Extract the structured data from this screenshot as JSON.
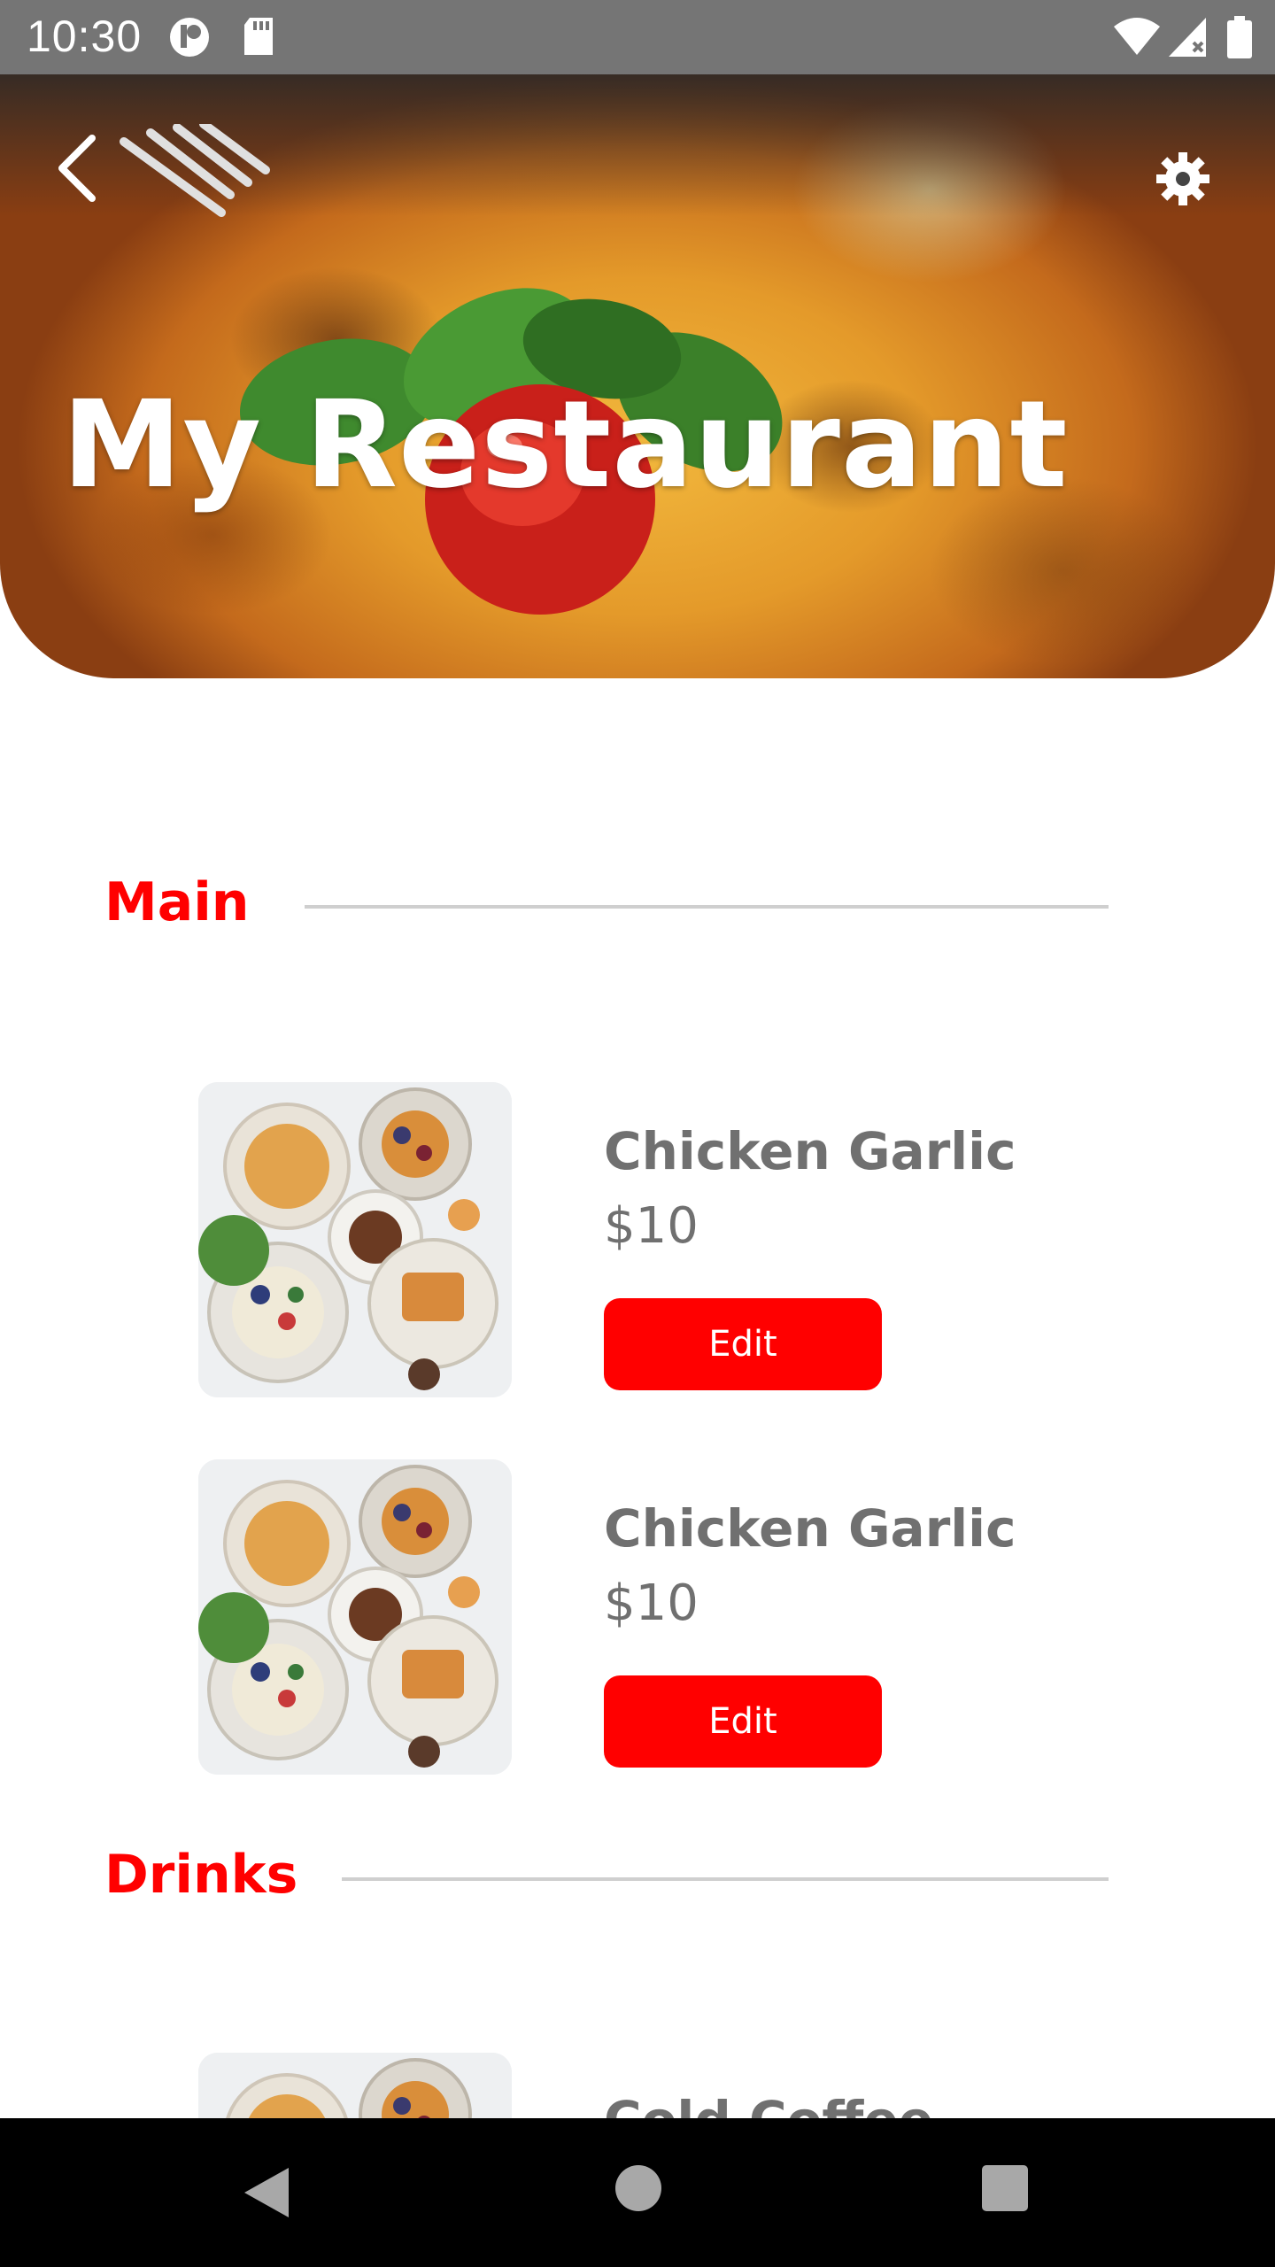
{
  "status_bar": {
    "time": "10:30",
    "icons": [
      "notification-icon",
      "sd-card-icon",
      "wifi-icon",
      "signal-icon",
      "battery-icon"
    ]
  },
  "header": {
    "title": "My Restaurant",
    "back_icon": "chevron-left-icon",
    "settings_icon": "gear-icon"
  },
  "sections": [
    {
      "title": "Main",
      "items": [
        {
          "name": "Chicken Garlic",
          "price": "$10",
          "button": "Edit",
          "image": "food-platter-image"
        },
        {
          "name": "Chicken Garlic",
          "price": "$10",
          "button": "Edit",
          "image": "food-platter-image"
        }
      ]
    },
    {
      "title": "Drinks",
      "items": [
        {
          "name": "Cold Coffee",
          "image": "food-platter-image"
        }
      ]
    }
  ],
  "nav_bar": {
    "buttons": [
      "back-triangle-icon",
      "home-circle-icon",
      "recents-square-icon"
    ]
  },
  "colors": {
    "accent": "#ff0000",
    "text_gray": "#707070",
    "status_bar": "#757575",
    "nav_bar": "#000000",
    "divider": "#cfcfcf"
  }
}
